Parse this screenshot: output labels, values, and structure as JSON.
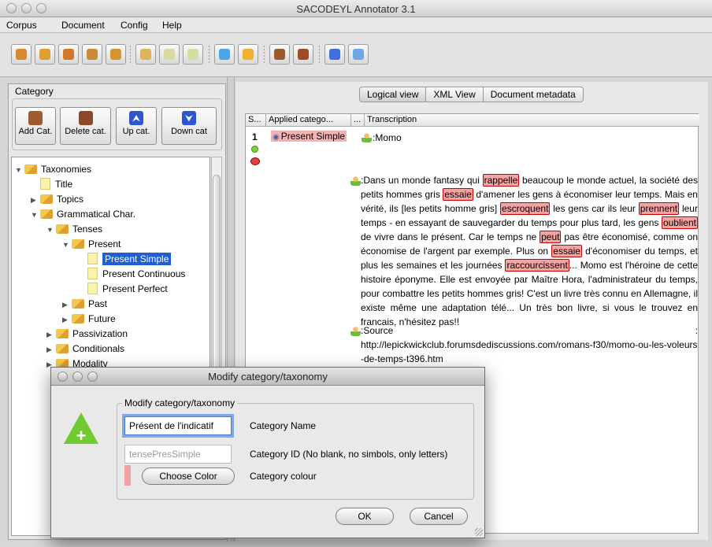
{
  "window": {
    "title": "SACODEYL Annotator 3.1"
  },
  "menu": [
    "Corpus",
    "Document",
    "Config",
    "Help"
  ],
  "toolbar_icons": [
    {
      "name": "open-corpus-icon",
      "color": "#d8892a"
    },
    {
      "name": "new-corpus-icon",
      "color": "#e0a030"
    },
    {
      "name": "save-corpus-icon",
      "color": "#d07a28"
    },
    {
      "name": "export-corpus-icon",
      "color": "#c98a3a"
    },
    {
      "name": "close-corpus-icon",
      "color": "#d5952f"
    },
    {
      "name": "edit-document-icon",
      "color": "#e0b25a"
    },
    {
      "name": "delete-document-icon",
      "color": "#d9d9a0"
    },
    {
      "name": "add-document-icon",
      "color": "#cfe0a0"
    },
    {
      "name": "config-icon",
      "color": "#4aa6e8"
    },
    {
      "name": "import-icon",
      "color": "#f0b030"
    },
    {
      "name": "annotate-icon",
      "color": "#9a5a2e"
    },
    {
      "name": "remove-annotation-icon",
      "color": "#a04a2a"
    },
    {
      "name": "info-icon",
      "color": "#3d6fe0"
    },
    {
      "name": "preview-icon",
      "color": "#6fa8e8"
    }
  ],
  "left_panel": {
    "group_label": "Category",
    "buttons": [
      {
        "label": "Add Cat.",
        "icon": "add-category-icon",
        "color": "#a05a30"
      },
      {
        "label": "Delete cat.",
        "icon": "delete-category-icon",
        "color": "#a05a30"
      },
      {
        "label": "Up cat.",
        "icon": "up-category-icon",
        "color": "#2f56d0"
      },
      {
        "label": "Down cat",
        "icon": "down-category-icon",
        "color": "#2f56d0"
      }
    ],
    "tree": [
      {
        "label": "Taxonomies",
        "indent": 0,
        "arrow": "▼",
        "kind": "folder"
      },
      {
        "label": "Title",
        "indent": 1,
        "arrow": "",
        "kind": "leaf"
      },
      {
        "label": "Topics",
        "indent": 1,
        "arrow": "▶",
        "kind": "folder"
      },
      {
        "label": "Grammatical Char.",
        "indent": 1,
        "arrow": "▼",
        "kind": "folder"
      },
      {
        "label": "Tenses",
        "indent": 2,
        "arrow": "▼",
        "kind": "folder"
      },
      {
        "label": "Present",
        "indent": 3,
        "arrow": "▼",
        "kind": "folder"
      },
      {
        "label": "Present Simple",
        "indent": 4,
        "arrow": "",
        "kind": "leaf",
        "selected": true
      },
      {
        "label": "Present Continuous",
        "indent": 4,
        "arrow": "",
        "kind": "leaf"
      },
      {
        "label": "Present Perfect",
        "indent": 4,
        "arrow": "",
        "kind": "leaf"
      },
      {
        "label": "Past",
        "indent": 3,
        "arrow": "▶",
        "kind": "folder"
      },
      {
        "label": "Future",
        "indent": 3,
        "arrow": "▶",
        "kind": "folder"
      },
      {
        "label": "Passivization",
        "indent": 2,
        "arrow": "▶",
        "kind": "folder"
      },
      {
        "label": "Conditionals",
        "indent": 2,
        "arrow": "▶",
        "kind": "folder"
      },
      {
        "label": "Modality",
        "indent": 2,
        "arrow": "▶",
        "kind": "folder"
      }
    ]
  },
  "right_panel": {
    "tabs": [
      "Logical view",
      "XML View",
      "Document metadata"
    ],
    "active_tab": 0,
    "columns": [
      "S...",
      "Applied catego...",
      "...",
      "Transcription"
    ],
    "row": {
      "seq": "1",
      "applied": "Present Simple",
      "speaker1": ":Momo",
      "paragraph": [
        {
          "t": ":Dans un monde fantasy qui "
        },
        {
          "t": "rappelle",
          "hl": true
        },
        {
          "t": " beaucoup le monde actuel, la société des petits hommes gris "
        },
        {
          "t": "essaie",
          "hl": true
        },
        {
          "t": " d'amener les gens à économiser leur temps. Mais en vérité, ils [les petits homme gris] "
        },
        {
          "t": "escroquent",
          "hl": true
        },
        {
          "t": " les gens car ils leur "
        },
        {
          "t": "prennent",
          "hl": true
        },
        {
          "t": " leur temps - en essayant de sauvegarder du temps pour plus tard, les gens "
        },
        {
          "t": "oublient",
          "hl": true
        },
        {
          "t": " de vivre dans le présent. Car le temps ne "
        },
        {
          "t": "peut",
          "hl": true
        },
        {
          "t": " pas être économisé, comme on économise de l'argent par exemple. Plus on "
        },
        {
          "t": "essaie",
          "hl": true
        },
        {
          "t": " d'économiser du temps, et plus les semaines et les journées "
        },
        {
          "t": "raccourcissent",
          "hl": true
        },
        {
          "t": "... Momo est l'héroine de cette histoire éponyme. Elle est envoyée par Maître Hora, l'administrateur du temps, pour combattre les petits hommes gris! C'est un livre très connu en Allemagne, il existe même une adaptation télé... Un très bon livre, si vous le trouvez en francais, n'hésitez pas!!"
        }
      ],
      "source_label": ":Source",
      "source_colon": ":",
      "source_url": "http://lepickwickclub.forumsdediscussions.com/romans-f30/momo-ou-les-voleurs-de-temps-t396.htm"
    }
  },
  "dialog": {
    "title": "Modify category/taxonomy",
    "group": "Modify category/taxonomy",
    "name_value": "Présent de l'indicatif",
    "name_label": "Category Name",
    "id_value": "tensePresSimple",
    "id_label": "Category ID (No blank, no simbols, only letters)",
    "color_button": "Choose Color",
    "color_label": "Category colour",
    "color": "#f4a3a3",
    "ok": "OK",
    "cancel": "Cancel"
  }
}
